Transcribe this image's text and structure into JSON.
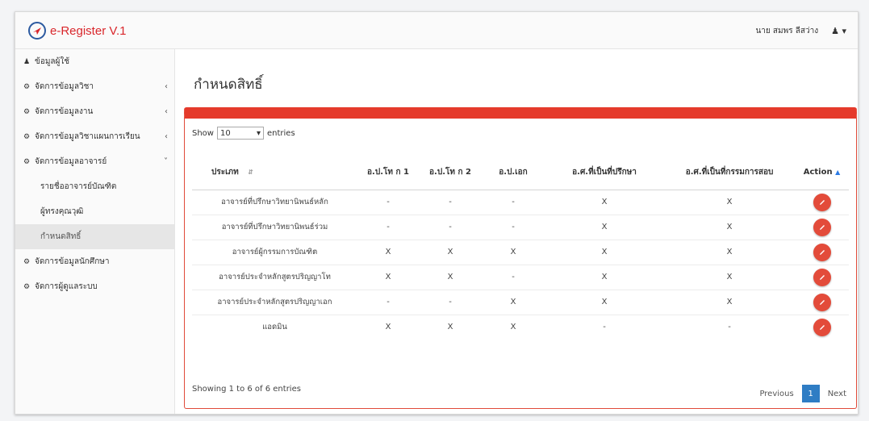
{
  "app": {
    "title": "e-Register V.1"
  },
  "user": {
    "name": "นาย สมพร ลีสว่าง",
    "icon": "user-icon"
  },
  "sidebar": {
    "items": [
      {
        "label": "ข้อมูลผู้ใช้",
        "icon": "users-icon",
        "chevron": ""
      },
      {
        "label": "จัดการข้อมูลวิชา",
        "icon": "cogs-icon",
        "chevron": "‹"
      },
      {
        "label": "จัดการข้อมูลงาน",
        "icon": "cogs-icon",
        "chevron": "‹"
      },
      {
        "label": "จัดการข้อมูลวิชาแผนการเรียน",
        "icon": "cogs-icon",
        "chevron": "‹"
      },
      {
        "label": "จัดการข้อมูลอาจารย์",
        "icon": "cogs-icon",
        "chevron": "˅"
      }
    ],
    "sub_items": [
      {
        "label": "รายชื่ออาจารย์บัณฑิต"
      },
      {
        "label": "ผู้ทรงคุณวุฒิ"
      },
      {
        "label": "กำหนดสิทธิ์"
      }
    ],
    "items_after": [
      {
        "label": "จัดการข้อมูลนักศึกษา",
        "icon": "cogs-icon"
      },
      {
        "label": "จัดการผู้ดูแลระบบ",
        "icon": "cogs-icon"
      }
    ]
  },
  "page": {
    "title": "กำหนดสิทธิ์"
  },
  "table_controls": {
    "show_label": "Show",
    "show_value": "10",
    "entries_label": "entries"
  },
  "table": {
    "headers": [
      "ประเภท",
      "อ.ป.โท ก 1",
      "อ.ป.โท ก 2",
      "อ.ป.เอก",
      "อ.ศ.ที่เป็นที่ปรึกษา",
      "อ.ศ.ที่เป็นที่กรรมการสอบ",
      "Action"
    ],
    "rows": [
      [
        "อาจารย์ที่ปรึกษาวิทยานิพนธ์หลัก",
        "-",
        "-",
        "-",
        "X",
        "X"
      ],
      [
        "อาจารย์ที่ปรึกษาวิทยานิพนธ์ร่วม",
        "-",
        "-",
        "-",
        "X",
        "X"
      ],
      [
        "อาจารย์ผู้กรรมการบัณฑิต",
        "X",
        "X",
        "X",
        "X",
        "X"
      ],
      [
        "อาจารย์ประจำหลักสูตรปริญญาโท",
        "X",
        "X",
        "-",
        "X",
        "X"
      ],
      [
        "อาจารย์ประจำหลักสูตรปริญญาเอก",
        "-",
        "-",
        "X",
        "X",
        "X"
      ],
      [
        "แอดมิน",
        "X",
        "X",
        "X",
        "-",
        "-"
      ]
    ]
  },
  "footer": {
    "info": "Showing 1 to 6 of 6 entries",
    "prev": "Previous",
    "current_page": "1",
    "next": "Next"
  },
  "colors": {
    "accent": "#e53a2b",
    "brand": "#d9262b",
    "pager": "#2f7dc4"
  }
}
